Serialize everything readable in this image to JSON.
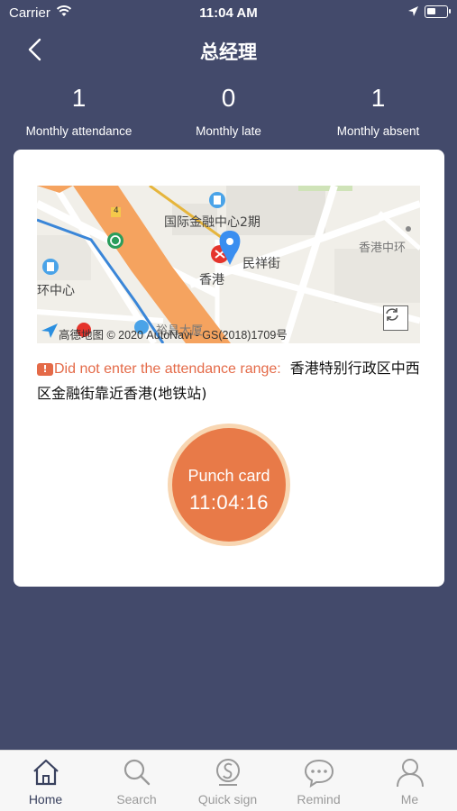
{
  "status_bar": {
    "carrier": "Carrier",
    "time": "11:04 AM",
    "wifi_icon": "wifi-icon",
    "location_icon": "location-arrow-icon",
    "battery_level": 0.3
  },
  "nav": {
    "back_icon": "chevron-left-icon",
    "title": "总经理"
  },
  "stats": [
    {
      "value": "1",
      "label": "Monthly attendance"
    },
    {
      "value": "0",
      "label": "Monthly late"
    },
    {
      "value": "1",
      "label": "Monthly absent"
    }
  ],
  "map": {
    "labels": {
      "ifc": "国际金融中心2期",
      "station": "香港",
      "street": "民祥街",
      "central_right": "香港中环",
      "central_left": "环中心",
      "bottom": "裕昌大厦",
      "marker_4": "4"
    },
    "copyright": "高德地图 © 2020 AutoNavi - GS(2018)1709号",
    "refresh_icon": "refresh-icon",
    "pin_icon": "location-pin-icon"
  },
  "warning": {
    "badge": "!",
    "message": "Did not enter the attendance range:",
    "address": "香港特别行政区中西区金融街靠近香港(地铁站)"
  },
  "punch": {
    "label": "Punch card",
    "time": "11:04:16"
  },
  "tabs": [
    {
      "label": "Home",
      "icon": "home-icon",
      "active": true
    },
    {
      "label": "Search",
      "icon": "search-icon",
      "active": false
    },
    {
      "label": "Quick sign",
      "icon": "quick-sign-icon",
      "active": false
    },
    {
      "label": "Remind",
      "icon": "chat-bubble-icon",
      "active": false
    },
    {
      "label": "Me",
      "icon": "person-icon",
      "active": false
    }
  ],
  "colors": {
    "background": "#434a6b",
    "accent": "#e87a48",
    "accent_ring": "#f8d6b2",
    "warning": "#e46a48",
    "tab_active": "#39415e",
    "tab_inactive": "#9a9a9a",
    "pin": "#3a8ef0"
  }
}
